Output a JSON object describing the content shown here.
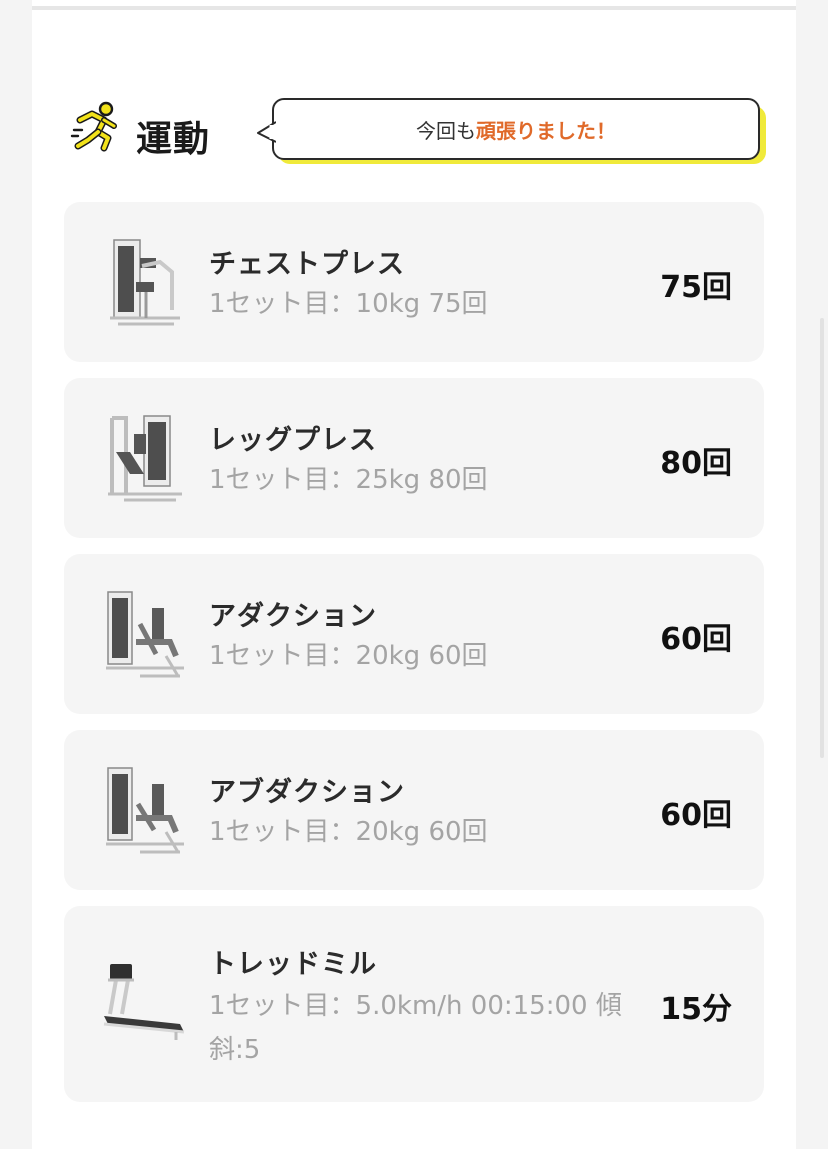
{
  "section": {
    "title": "運動",
    "icon": "running-person-icon",
    "bubble_prefix": "今回も",
    "bubble_emphasis": "頑張りました！"
  },
  "colors": {
    "accent_orange": "#e06a2a",
    "bubble_shadow_yellow": "#f0ea3a",
    "icon_yellow": "#f2e21a"
  },
  "exercises": [
    {
      "name": "チェストプレス",
      "detail": "1セット目：10kg 75回",
      "count": "75回",
      "icon": "chest-press-machine-icon"
    },
    {
      "name": "レッグプレス",
      "detail": "1セット目：25kg 80回",
      "count": "80回",
      "icon": "leg-press-machine-icon"
    },
    {
      "name": "アダクション",
      "detail": "1セット目：20kg 60回",
      "count": "60回",
      "icon": "adduction-machine-icon"
    },
    {
      "name": "アブダクション",
      "detail": "1セット目：20kg 60回",
      "count": "60回",
      "icon": "abduction-machine-icon"
    },
    {
      "name": "トレッドミル",
      "detail": "1セット目：5.0km/h 00:15:00 傾斜:5",
      "count": "15分",
      "icon": "treadmill-icon"
    }
  ]
}
